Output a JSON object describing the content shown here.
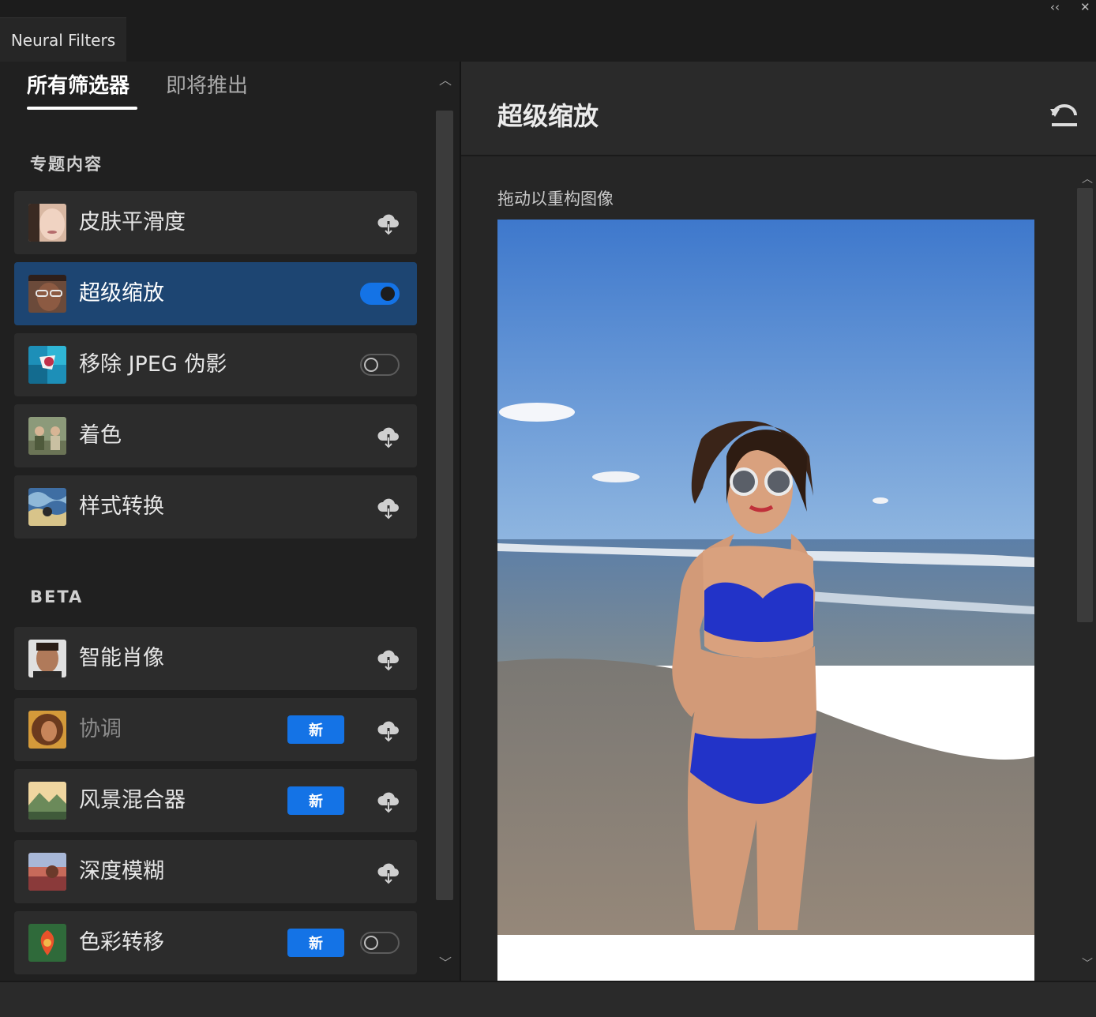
{
  "window": {
    "tab_title": "Neural Filters",
    "collapse_glyph": "‹‹",
    "close_glyph": "✕"
  },
  "left": {
    "tabs": [
      {
        "label": "所有筛选器",
        "active": true
      },
      {
        "label": "即将推出",
        "active": false
      }
    ],
    "featured_title": "专题内容",
    "beta_title": "BETA",
    "featured_items": [
      {
        "label": "皮肤平滑度",
        "state": "download"
      },
      {
        "label": "超级缩放",
        "state": "toggle-on",
        "selected": true
      },
      {
        "label": "移除 JPEG 伪影",
        "state": "toggle-off"
      },
      {
        "label": "着色",
        "state": "download"
      },
      {
        "label": "样式转换",
        "state": "download"
      }
    ],
    "beta_items": [
      {
        "label": "智能肖像",
        "state": "download"
      },
      {
        "label": "协调",
        "state": "download",
        "badge": "新",
        "dim": true
      },
      {
        "label": "风景混合器",
        "state": "download",
        "badge": "新"
      },
      {
        "label": "深度模糊",
        "state": "download"
      },
      {
        "label": "色彩转移",
        "state": "toggle-off",
        "badge": "新"
      }
    ]
  },
  "right": {
    "title": "超级缩放",
    "drag_hint": "拖动以重构图像",
    "up_arrow": "︿",
    "down_arrow": "﹀"
  },
  "colors": {
    "accent": "#1473e6",
    "selected_row": "#1d4572"
  }
}
